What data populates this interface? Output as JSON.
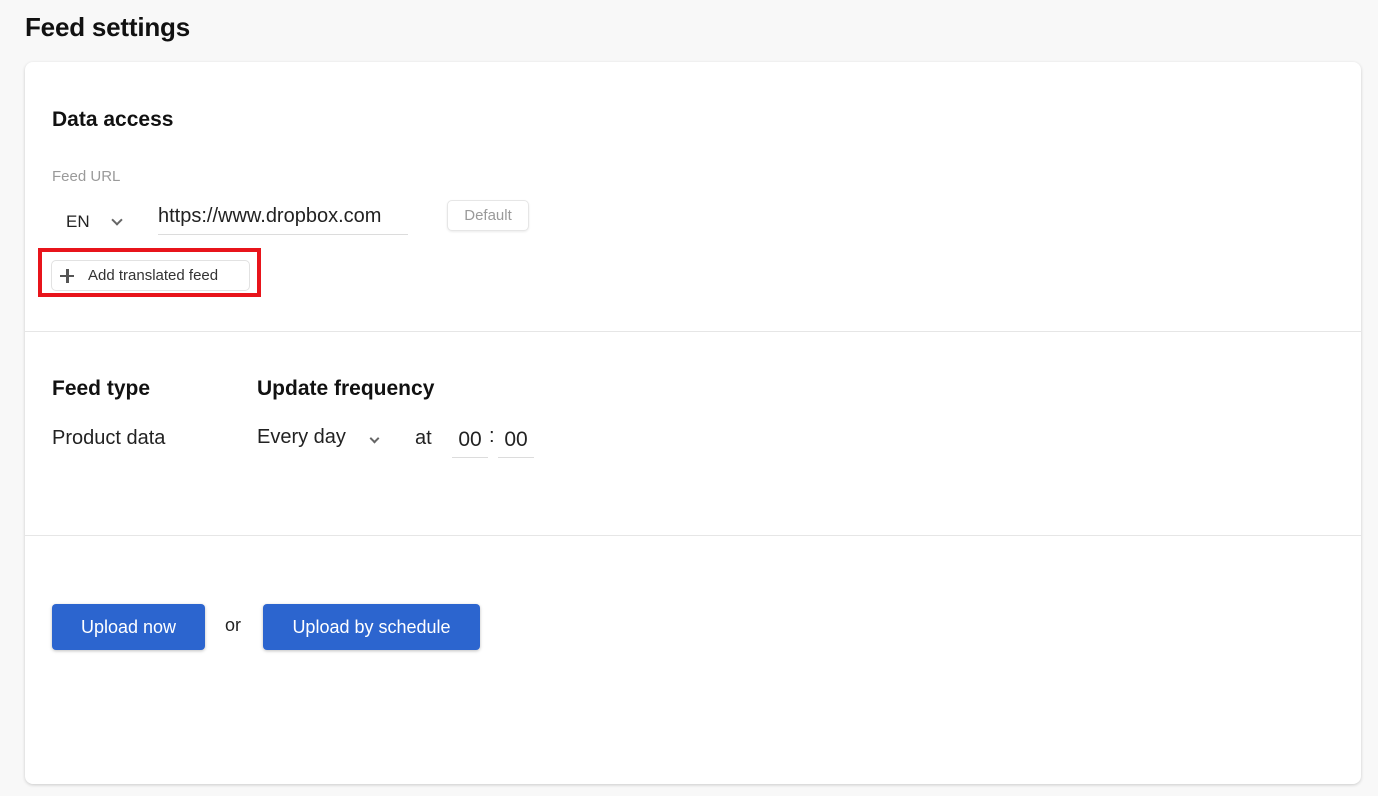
{
  "page": {
    "title": "Feed settings"
  },
  "data_access": {
    "title": "Data access",
    "feed_url_label": "Feed URL",
    "language": {
      "selected": "EN",
      "icon": "chevron-down-icon"
    },
    "url_value": "https://www.dropbox.com",
    "default_button_label": "Default",
    "add_translated_feed": {
      "label": "Add translated feed",
      "icon": "plus-icon"
    },
    "highlight_color": "#e8141b"
  },
  "feed_type": {
    "title": "Feed type",
    "value": "Product data"
  },
  "update_frequency": {
    "title": "Update frequency",
    "selected": "Every day",
    "at_label": "at",
    "hour": "00",
    "separator": ":",
    "minute": "00"
  },
  "actions": {
    "upload_now_label": "Upload now",
    "or_label": "or",
    "upload_by_schedule_label": "Upload by schedule",
    "primary_color": "#2c65cf"
  }
}
